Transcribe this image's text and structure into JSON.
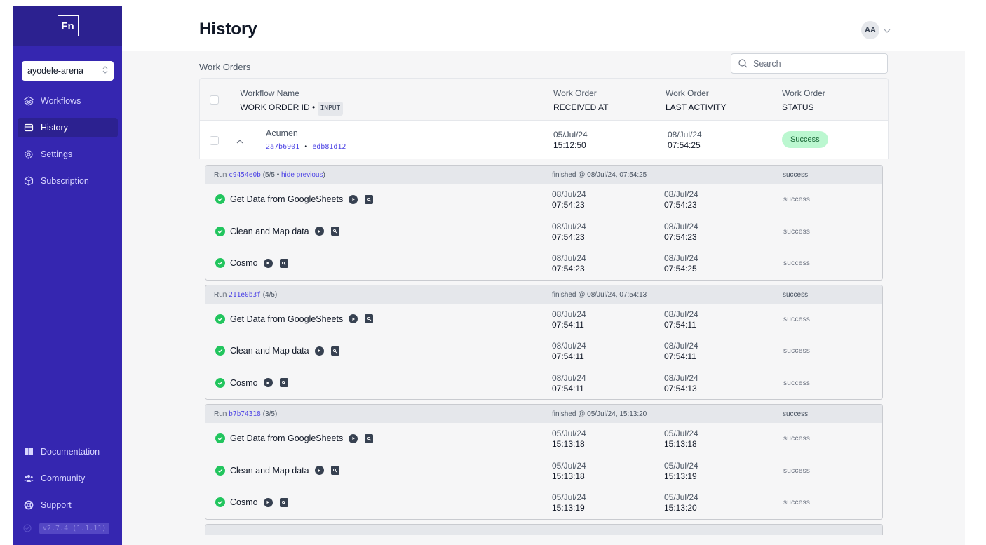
{
  "sidebar": {
    "logo": "Fn",
    "project": "ayodele-arena",
    "nav": [
      {
        "label": "Workflows",
        "icon": "layers-icon"
      },
      {
        "label": "History",
        "icon": "inbox-icon"
      },
      {
        "label": "Settings",
        "icon": "gear-icon"
      },
      {
        "label": "Subscription",
        "icon": "cube-icon"
      }
    ],
    "bottom_nav": [
      {
        "label": "Documentation",
        "icon": "book-icon"
      },
      {
        "label": "Community",
        "icon": "users-icon"
      },
      {
        "label": "Support",
        "icon": "lifebuoy-icon"
      }
    ],
    "version": "v2.7.4 (1.1.11)"
  },
  "header": {
    "title": "History",
    "user_initials": "AA"
  },
  "main": {
    "section_title": "Work Orders",
    "search_placeholder": "Search",
    "columns": {
      "name_top": "Workflow Name",
      "name_sub": "WORK ORDER ID",
      "name_sep": "•",
      "input_tag": "INPUT",
      "received_top": "Work Order",
      "received_sub": "RECEIVED AT",
      "activity_top": "Work Order",
      "activity_sub": "LAST ACTIVITY",
      "status_top": "Work Order",
      "status_sub": "STATUS"
    },
    "work_order": {
      "name": "Acumen",
      "id": "2a7b6901",
      "input_id": "edb81d12",
      "sep": "•",
      "received_date": "05/Jul/24",
      "received_time": "15:12:50",
      "activity_date": "08/Jul/24",
      "activity_time": "07:54:25",
      "status": "Success"
    },
    "runs": [
      {
        "prefix": "Run",
        "id": "c9454e0b",
        "count_open": "(5/5",
        "sep": "•",
        "hide_label": "hide previous",
        "count_close": ")",
        "finished": "finished @ 08/Jul/24, 07:54:25",
        "status": "success",
        "steps": [
          {
            "name": "Get Data from GoogleSheets",
            "d1": "08/Jul/24",
            "t1": "07:54:23",
            "d2": "08/Jul/24",
            "t2": "07:54:23",
            "status": "success"
          },
          {
            "name": "Clean and Map data",
            "d1": "08/Jul/24",
            "t1": "07:54:23",
            "d2": "08/Jul/24",
            "t2": "07:54:23",
            "status": "success"
          },
          {
            "name": "Cosmo",
            "d1": "08/Jul/24",
            "t1": "07:54:23",
            "d2": "08/Jul/24",
            "t2": "07:54:25",
            "status": "success"
          }
        ]
      },
      {
        "prefix": "Run",
        "id": "211e0b3f",
        "count_open": "(4/5)",
        "sep": "",
        "hide_label": "",
        "count_close": "",
        "finished": "finished @ 08/Jul/24, 07:54:13",
        "status": "success",
        "steps": [
          {
            "name": "Get Data from GoogleSheets",
            "d1": "08/Jul/24",
            "t1": "07:54:11",
            "d2": "08/Jul/24",
            "t2": "07:54:11",
            "status": "success"
          },
          {
            "name": "Clean and Map data",
            "d1": "08/Jul/24",
            "t1": "07:54:11",
            "d2": "08/Jul/24",
            "t2": "07:54:11",
            "status": "success"
          },
          {
            "name": "Cosmo",
            "d1": "08/Jul/24",
            "t1": "07:54:11",
            "d2": "08/Jul/24",
            "t2": "07:54:13",
            "status": "success"
          }
        ]
      },
      {
        "prefix": "Run",
        "id": "b7b74318",
        "count_open": "(3/5)",
        "sep": "",
        "hide_label": "",
        "count_close": "",
        "finished": "finished @ 05/Jul/24, 15:13:20",
        "status": "success",
        "steps": [
          {
            "name": "Get Data from GoogleSheets",
            "d1": "05/Jul/24",
            "t1": "15:13:18",
            "d2": "05/Jul/24",
            "t2": "15:13:18",
            "status": "success"
          },
          {
            "name": "Clean and Map data",
            "d1": "05/Jul/24",
            "t1": "15:13:18",
            "d2": "05/Jul/24",
            "t2": "15:13:19",
            "status": "success"
          },
          {
            "name": "Cosmo",
            "d1": "05/Jul/24",
            "t1": "15:13:19",
            "d2": "05/Jul/24",
            "t2": "15:13:20",
            "status": "success"
          }
        ]
      }
    ]
  }
}
